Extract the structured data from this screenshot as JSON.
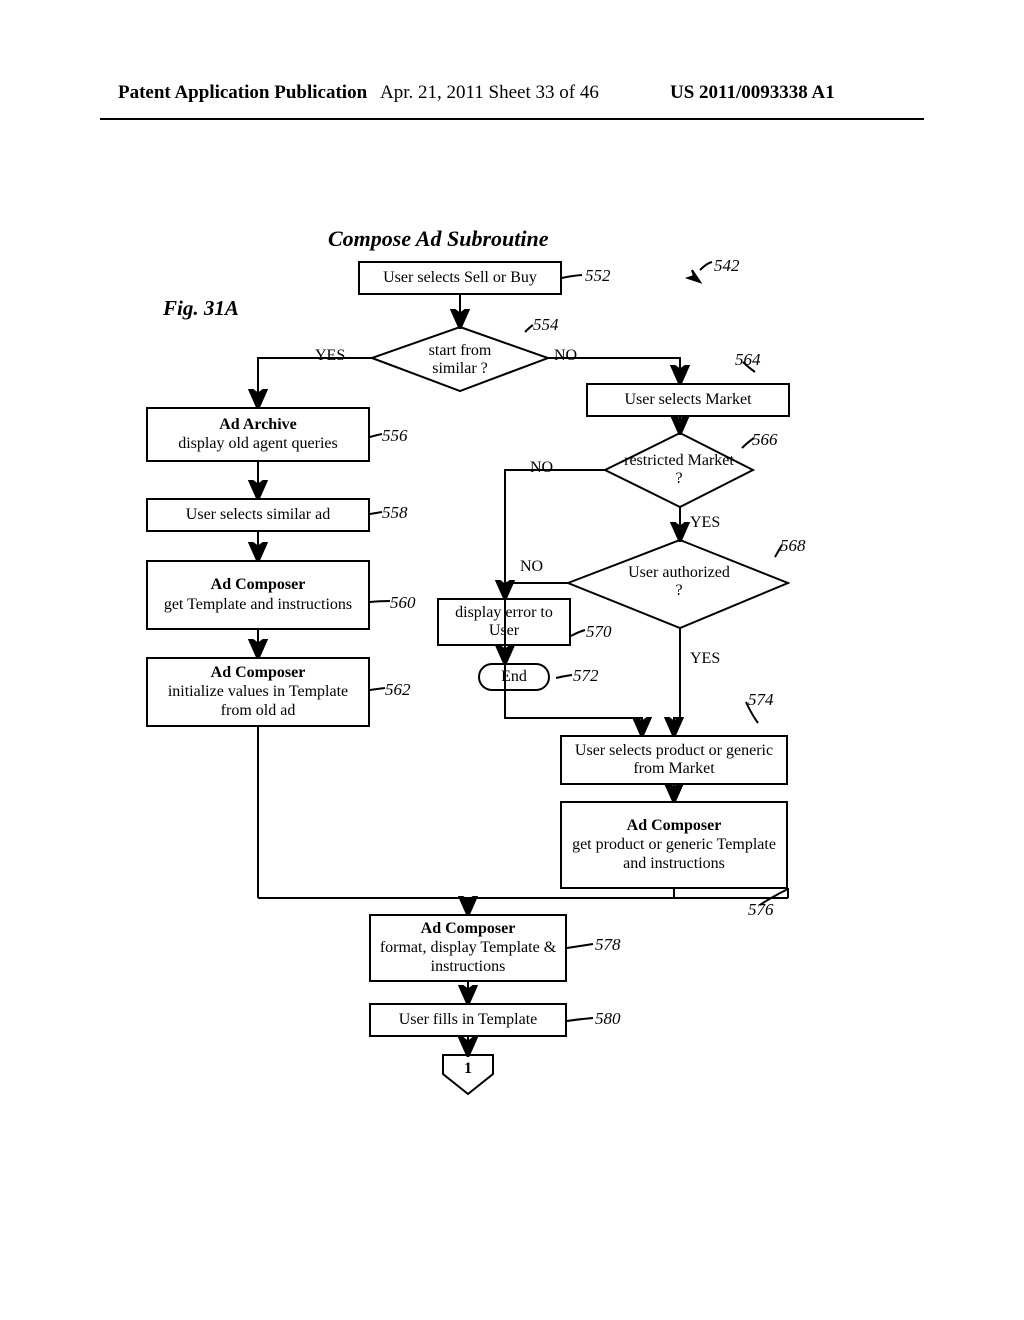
{
  "header": {
    "left": "Patent Application Publication",
    "mid": "Apr. 21, 2011  Sheet 33 of 46",
    "right": "US 2011/0093338 A1"
  },
  "diagram": {
    "title": "Compose Ad Subroutine",
    "figure_label": "Fig. 31A",
    "n552": "User selects Sell or Buy",
    "n554": "start from similar ?",
    "n556_heading": "Ad Archive",
    "n556_body": "display old agent queries",
    "n558": "User selects similar ad",
    "n560_heading": "Ad Composer",
    "n560_body": "get Template and instructions",
    "n562_heading": "Ad Composer",
    "n562_body": "initialize values in Template from old ad",
    "n564": "User selects Market",
    "n566": "restricted Market ?",
    "n568": "User authorized ?",
    "n570": "display error to User",
    "end": "End",
    "n574": "User selects product or generic from Market",
    "n576_heading": "Ad Composer",
    "n576_body": "get product or generic Template and instructions",
    "n578_heading": "Ad Composer",
    "n578_body": "format, display Template & instructions",
    "n580": "User fills in Template",
    "offpage": "1",
    "yes": "YES",
    "no": "NO",
    "refs": {
      "r542": "542",
      "r552": "552",
      "r554": "554",
      "r556": "556",
      "r558": "558",
      "r560": "560",
      "r562": "562",
      "r564": "564",
      "r566": "566",
      "r568": "568",
      "r570": "570",
      "r572": "572",
      "r574": "574",
      "r576": "576",
      "r578": "578",
      "r580": "580"
    }
  }
}
